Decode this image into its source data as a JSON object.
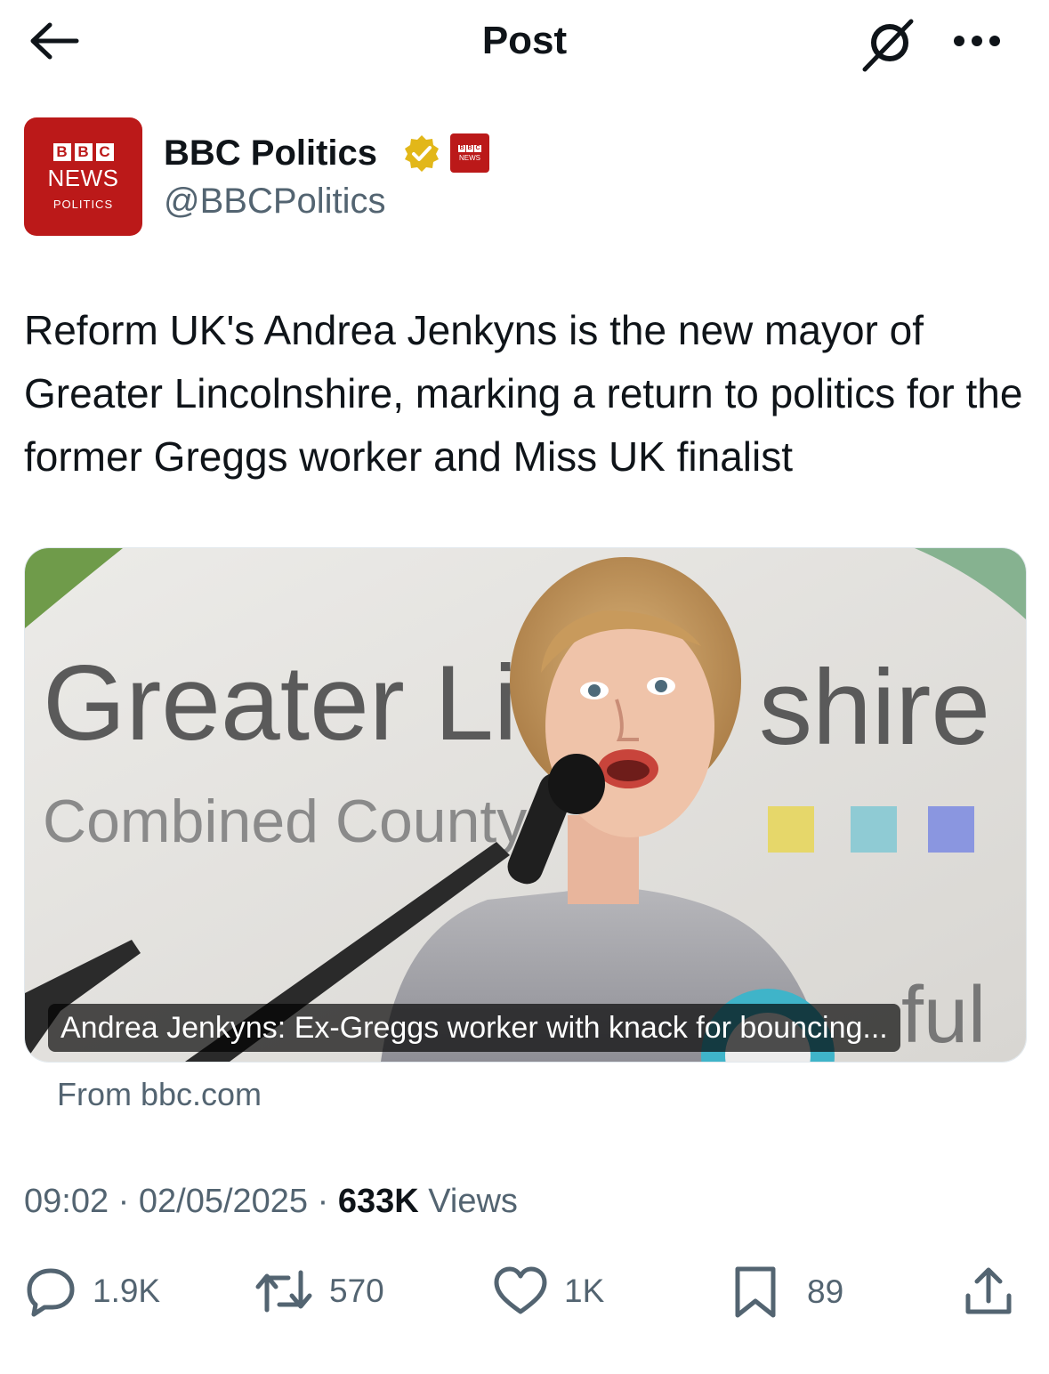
{
  "header": {
    "title": "Post",
    "back_icon": "arrow-left-icon",
    "grok_icon": "grok-icon",
    "more_icon": "more-dots-icon"
  },
  "author": {
    "name": "BBC Politics",
    "handle": "@BBCPolitics",
    "verified_color": "#e2b719",
    "avatar": {
      "blocks": [
        "B",
        "B",
        "C"
      ],
      "news": "NEWS",
      "sub": "POLITICS",
      "bg": "#bb1919"
    },
    "affiliate_badge": {
      "blocks": [
        "B",
        "B",
        "C"
      ],
      "news": "NEWS"
    }
  },
  "post": {
    "text": "Reform UK's Andrea Jenkyns is the new mayor of Greater Lincolnshire, marking a return to politics for the former Greggs worker and Miss UK finalist",
    "card": {
      "title": "Andrea Jenkyns: Ex-Greggs worker with knack for bouncing...",
      "source": "From bbc.com",
      "image_text": {
        "line1": "Greater Lir",
        "line1b": "shire",
        "line2": "Combined County",
        "line3": "ful"
      }
    },
    "time": "09:02",
    "date": "02/05/2025",
    "sep": "·",
    "views_count": "633K",
    "views_label": "Views"
  },
  "actions": {
    "reply": {
      "icon": "reply-icon",
      "count": "1.9K"
    },
    "retweet": {
      "icon": "retweet-icon",
      "count": "570"
    },
    "like": {
      "icon": "heart-icon",
      "count": "1K"
    },
    "bookmark": {
      "icon": "bookmark-icon",
      "count": "89"
    },
    "share": {
      "icon": "share-icon"
    }
  }
}
